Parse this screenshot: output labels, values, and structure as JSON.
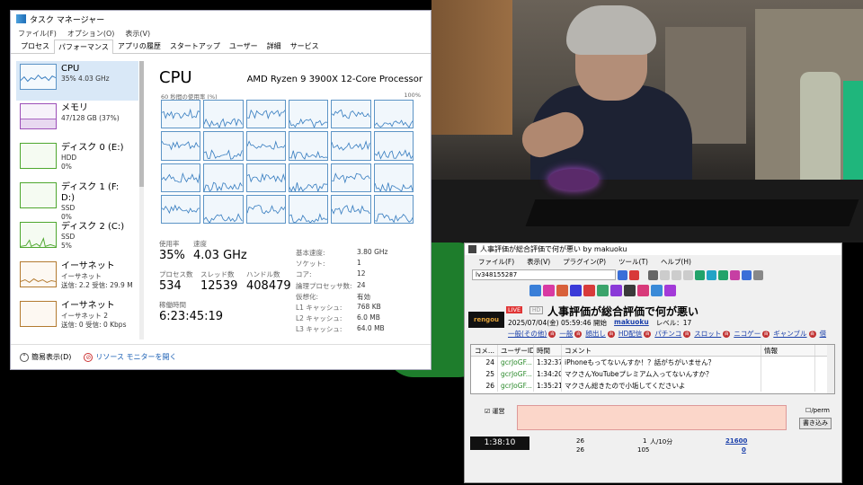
{
  "taskmgr": {
    "title": "タスク マネージャー",
    "menu": [
      "ファイル(F)",
      "オプション(O)",
      "表示(V)"
    ],
    "tabs": [
      "プロセス",
      "パフォーマンス",
      "アプリの履歴",
      "スタートアップ",
      "ユーザー",
      "詳細",
      "サービス"
    ],
    "active_tab": 1,
    "sidebar": [
      {
        "name": "CPU",
        "sub1": "35%  4.03 GHz",
        "sub2": "",
        "kind": "cpu"
      },
      {
        "name": "メモリ",
        "sub1": "47/128 GB (37%)",
        "sub2": "",
        "kind": "mem"
      },
      {
        "name": "ディスク 0 (E:)",
        "sub1": "HDD",
        "sub2": "0%",
        "kind": "disk"
      },
      {
        "name": "ディスク 1 (F: D:)",
        "sub1": "SSD",
        "sub2": "0%",
        "kind": "disk"
      },
      {
        "name": "ディスク 2 (C:)",
        "sub1": "SSD",
        "sub2": "5%",
        "kind": "disk"
      },
      {
        "name": "イーサネット",
        "sub1": "イーサネット",
        "sub2": "送信: 2.2  受信: 29.9 M",
        "kind": "net"
      },
      {
        "name": "イーサネット",
        "sub1": "イーサネット 2",
        "sub2": "送信: 0  受信: 0 Kbps",
        "kind": "net"
      }
    ],
    "main": {
      "title": "CPU",
      "model": "AMD Ryzen 9 3900X 12-Core Processor",
      "graph_label": "60 秒間の使用率 (%)",
      "graph_max": "100%",
      "usage_label": "使用率",
      "usage_value": "35%",
      "speed_label": "速度",
      "speed_value": "4.03 GHz",
      "proc_label": "プロセス数",
      "proc_value": "534",
      "thread_label": "スレッド数",
      "thread_value": "12539",
      "handle_label": "ハンドル数",
      "handle_value": "408479",
      "uptime_label": "稼働時間",
      "uptime_value": "6:23:45:19",
      "specs": [
        {
          "k": "基本速度:",
          "v": "3.80 GHz"
        },
        {
          "k": "ソケット:",
          "v": "1"
        },
        {
          "k": "コア:",
          "v": "12"
        },
        {
          "k": "論理プロセッサ数:",
          "v": "24"
        },
        {
          "k": "仮想化:",
          "v": "有効"
        },
        {
          "k": "L1 キャッシュ:",
          "v": "768 KB"
        },
        {
          "k": "L2 キャッシュ:",
          "v": "6.0 MB"
        },
        {
          "k": "L3 キャッシュ:",
          "v": "64.0 MB"
        }
      ]
    },
    "footer": {
      "fewer": "簡易表示(D)",
      "resmon": "リソース モニターを開く"
    }
  },
  "viewer": {
    "title": "人事評価が総合評価で何が悪い by makuoku",
    "menu": [
      "ファイル(F)",
      "表示(V)",
      "プラグイン(P)",
      "ツール(T)",
      "ヘルプ(H)"
    ],
    "lv": "lv348155287",
    "live": "LIVE",
    "hd": "HD",
    "prog_title": "人事評価が総合評価で何が悪い",
    "date": "2025/07/04(金) 05:59:46 開始",
    "user": "makuoku",
    "level": "レベル：17",
    "tags": [
      "一般(その他)",
      "一般",
      "顔出し",
      "HD配信",
      "パチンコ",
      "スロット",
      "ニコゲー",
      "ギャンブル",
      "借"
    ],
    "columns": [
      "コメ...",
      "ユーザーID",
      "時間",
      "コメント",
      "情報"
    ],
    "rows": [
      {
        "no": "24",
        "id": "gcrJoGF...",
        "time": "1:32:37",
        "text": "iPhoneもってないんすか！？話がちがいません？",
        "info": ""
      },
      {
        "no": "25",
        "id": "gcrJoGF...",
        "time": "1:34:20",
        "text": "マクさんYouTubeプレミアム入ってないんすか？",
        "info": ""
      },
      {
        "no": "26",
        "id": "gcrJoGF...",
        "time": "1:35:21",
        "text": "マクさん総きたので小垢してくださいよ",
        "info": ""
      }
    ],
    "uneigai": "運営",
    "perm": "/perm",
    "post": "書き込み",
    "elapsed": "1:38:10",
    "stat_comments": "26",
    "stat_comments2": "26",
    "stat_viewers": "1",
    "stat_viewers_unit": "人/10分",
    "stat_total": "105",
    "stat_ad": "21600",
    "stat_ad2": "0"
  }
}
